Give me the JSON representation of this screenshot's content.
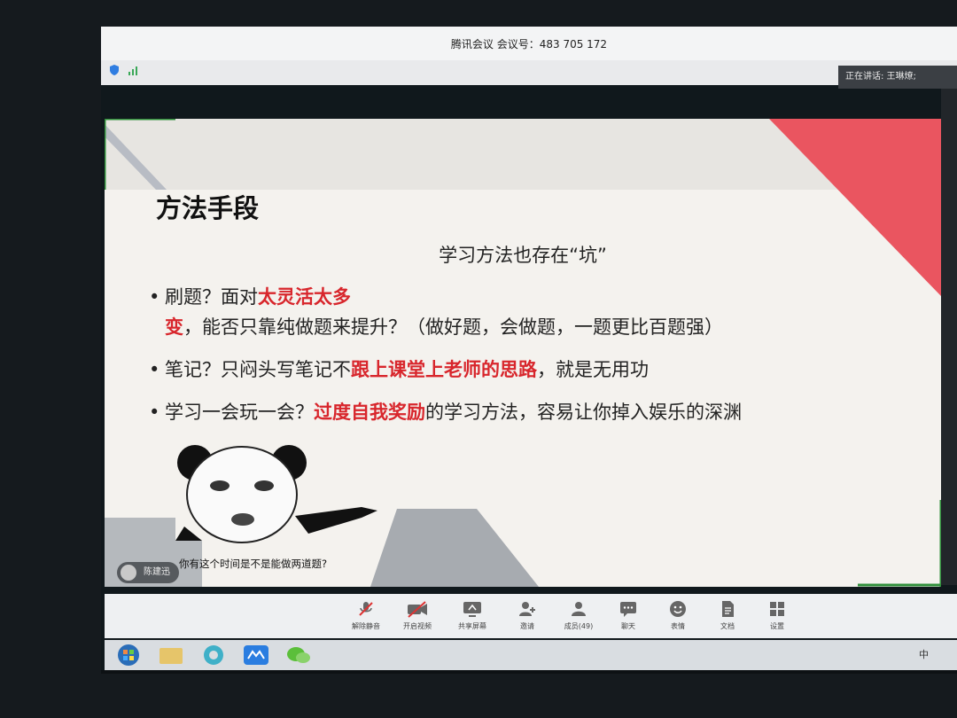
{
  "window": {
    "title": "腾讯会议 会议号：483 705 172"
  },
  "speaking": {
    "label": "正在讲话: 王琳燎;"
  },
  "slide": {
    "title": "方法手段",
    "subtitle": "学习方法也存在“坑”",
    "bullets": [
      {
        "pre": "刷题？面对",
        "hl": "太灵活太多变",
        "post": "，能否只靠纯做题来提升？（做好题，会做题，一题更比百题强）"
      },
      {
        "pre": "笔记？只闷头写笔记不",
        "hl": "跟上课堂上老师的思路",
        "post": "，就是无用功"
      },
      {
        "pre": "学习一会玩一会？",
        "hl": "过度自我奖励",
        "post": "的学习方法，容易让你掉入娱乐的深渊"
      }
    ],
    "meme_caption": "你有这个时间是不是能做两道题?",
    "presenter_name": "陈建迅",
    "accent_color": "#d8262c"
  },
  "toolbar": {
    "items": [
      {
        "label": "解除静音",
        "icon": "mic-muted-icon"
      },
      {
        "label": "开启视频",
        "icon": "camera-off-icon"
      },
      {
        "label": "共享屏幕",
        "icon": "share-screen-icon"
      },
      {
        "label": "邀请",
        "icon": "invite-icon"
      },
      {
        "label": "成员(49)",
        "icon": "members-icon"
      },
      {
        "label": "聊天",
        "icon": "chat-icon"
      },
      {
        "label": "表情",
        "icon": "emoji-icon"
      },
      {
        "label": "文档",
        "icon": "document-icon"
      },
      {
        "label": "设置",
        "icon": "settings-icon"
      }
    ]
  },
  "ime": {
    "label": "中"
  }
}
